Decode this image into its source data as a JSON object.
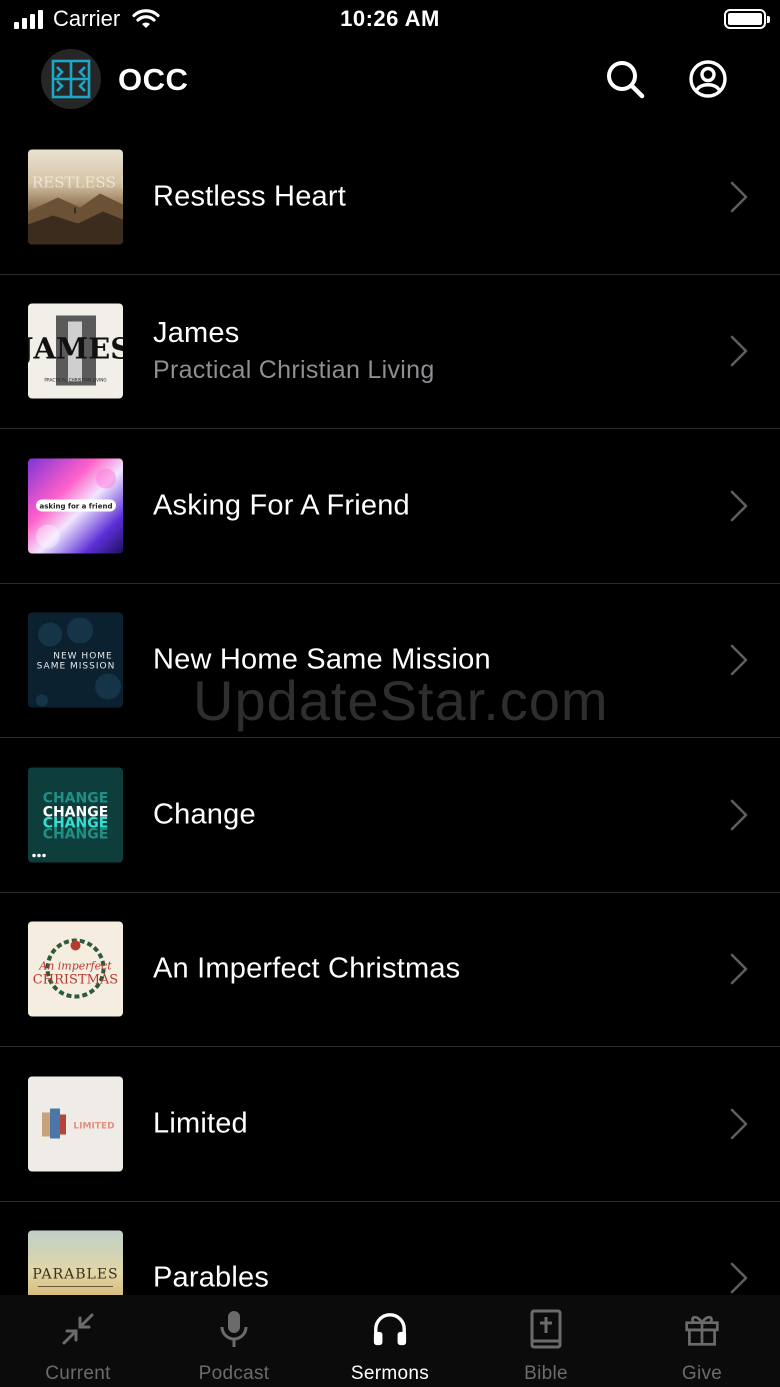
{
  "status_bar": {
    "carrier": "Carrier",
    "time": "10:26 AM"
  },
  "header": {
    "title": "OCC",
    "logo_icon": "church-logo-icon",
    "search_icon": "search-icon",
    "profile_icon": "profile-icon"
  },
  "sermons": [
    {
      "title": "Restless Heart",
      "subtitle": "",
      "thumbnail_text": "RESTLESS HEART"
    },
    {
      "title": "James",
      "subtitle": "Practical Christian Living",
      "thumbnail_text": "JAMES",
      "thumbnail_subtext": "PRACTICAL CHRISTIAN LIVING"
    },
    {
      "title": "Asking For A Friend",
      "subtitle": "",
      "thumbnail_text": "asking for a friend"
    },
    {
      "title": "New Home Same Mission",
      "subtitle": "",
      "thumbnail_text": "NEW HOME",
      "thumbnail_subtext": "SAME MISSION"
    },
    {
      "title": "Change",
      "subtitle": "",
      "thumbnail_text": "CHANGE"
    },
    {
      "title": "An Imperfect Christmas",
      "subtitle": "",
      "thumbnail_text": "An imperfect",
      "thumbnail_subtext": "CHRISTMAS"
    },
    {
      "title": "Limited",
      "subtitle": "",
      "thumbnail_text": "LIMITED"
    },
    {
      "title": "Parables",
      "subtitle": "",
      "thumbnail_text": "PARABLES"
    }
  ],
  "watermark": "UpdateStar.com",
  "tabs": [
    {
      "label": "Current",
      "icon": "collapse-arrows-icon",
      "active": false
    },
    {
      "label": "Podcast",
      "icon": "microphone-icon",
      "active": false
    },
    {
      "label": "Sermons",
      "icon": "headphones-icon",
      "active": true
    },
    {
      "label": "Bible",
      "icon": "bible-icon",
      "active": false
    },
    {
      "label": "Give",
      "icon": "gift-icon",
      "active": false
    }
  ],
  "colors": {
    "background": "#000000",
    "divider": "#2c2c2e",
    "subtitle": "#8e8e93",
    "tab_inactive": "#6b6b6b",
    "tab_active": "#ffffff",
    "logo_accent": "#1aa7c9"
  }
}
